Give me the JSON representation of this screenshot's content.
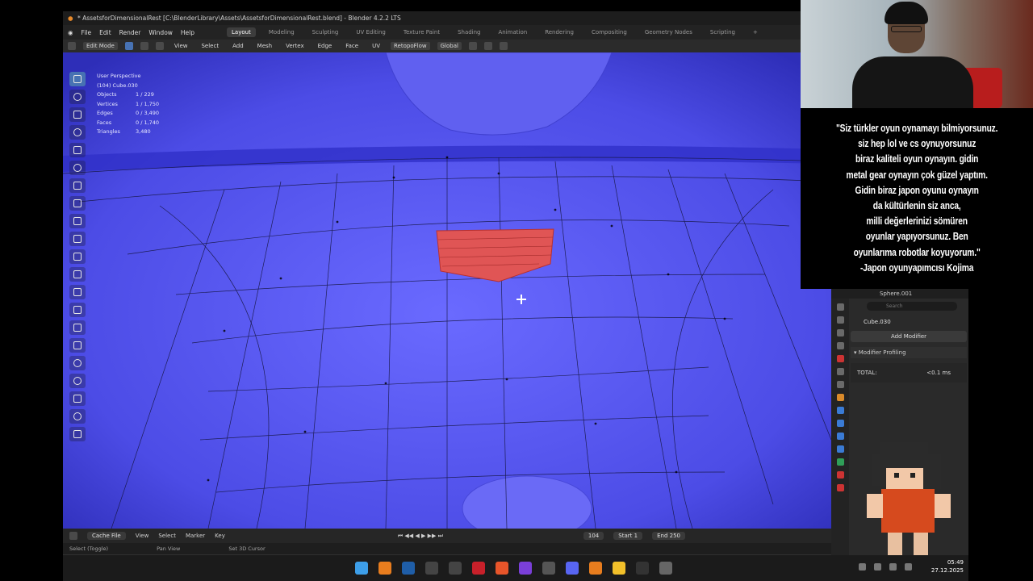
{
  "window": {
    "title": "* AssetsforDimensionalRest [C:\\BlenderLibrary\\Assets\\AssetsforDimensionalRest.blend] - Blender 4.2.2 LTS"
  },
  "menu": {
    "items": [
      "File",
      "Edit",
      "Render",
      "Window",
      "Help"
    ],
    "workspaces": [
      "Layout",
      "Modeling",
      "Sculpting",
      "UV Editing",
      "Texture Paint",
      "Shading",
      "Animation",
      "Rendering",
      "Compositing",
      "Geometry Nodes",
      "Scripting"
    ],
    "active_workspace": "Layout",
    "add_workspace": "+"
  },
  "header": {
    "mode": "Edit Mode",
    "menus": [
      "View",
      "Select",
      "Add",
      "Mesh",
      "Vertex",
      "Edge",
      "Face",
      "UV"
    ],
    "addon": "RetopoFlow",
    "orientation": "Global"
  },
  "viewport": {
    "perspective": "User Perspective",
    "object": "(104) Cube.030",
    "stats": [
      {
        "label": "Objects",
        "value": "1 / 229"
      },
      {
        "label": "Vertices",
        "value": "1 / 1,750"
      },
      {
        "label": "Edges",
        "value": "0 / 3,490"
      },
      {
        "label": "Faces",
        "value": "0 / 1,740"
      },
      {
        "label": "Triangles",
        "value": "3,480"
      }
    ],
    "colors": {
      "mesh": "#5252ee",
      "selection": "#e05555",
      "wire": "#1a1a4a"
    }
  },
  "timeline": {
    "cache": "Cache File",
    "menus": [
      "View",
      "Select",
      "Marker",
      "Key"
    ],
    "current_frame": "104",
    "start_label": "Start",
    "start": "1",
    "end_label": "End",
    "end": "250"
  },
  "statusbar": {
    "items": [
      "Select (Toggle)",
      "Pan View",
      "Set 3D Cursor"
    ]
  },
  "properties": {
    "object_header": "Sphere.001",
    "search_placeholder": "Search",
    "object_name": "Cube.030",
    "add_modifier": "Add Modifier",
    "panel_title": "Modifier Profiling",
    "total_label": "TOTAL:",
    "total_value": "<0.1 ms",
    "version": "4.2.2"
  },
  "overlay": {
    "quote_lines": [
      "\"Siz türkler oyun oynamayı bilmiyorsunuz.",
      "siz hep lol ve cs oynuyorsunuz",
      "biraz kaliteli oyun oynayın. gidin",
      "metal gear oynayın çok güzel yaptım.",
      "Gidin biraz japon oyunu oynayın",
      "da kültürlenin siz anca,",
      "milli değerlerinizi sömüren",
      "oyunlar yapıyorsunuz. Ben",
      "oyunlarıma robotlar koyuyorum.\"",
      "-Japon oyunyapımcısı Kojima"
    ]
  },
  "taskbar": {
    "time": "05:49",
    "date": "27.12.2025"
  }
}
